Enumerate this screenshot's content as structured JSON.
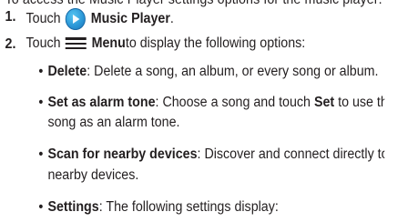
{
  "cut_top_line": "To access the Music Player settings options for the music player:",
  "steps": [
    {
      "num": "1.",
      "prefix": "Touch",
      "icon": "music-player-icon",
      "label": "Music Player",
      "suffix": "."
    },
    {
      "num": "2.",
      "prefix": "Touch",
      "icon": "menu-icon",
      "label": "Menu",
      "suffix": " to display the following options:"
    }
  ],
  "options": [
    {
      "term": "Delete",
      "desc": ": Delete a song, an album, or every song or album."
    },
    {
      "term": "Set as alarm tone",
      "desc": ": Choose a song and touch ",
      "inline_bold": "Set",
      "desc_end": " to use the",
      "continuation": "song as an alarm tone."
    },
    {
      "term": "Scan for nearby devices",
      "desc": ": Discover and connect directly to",
      "continuation": "nearby devices."
    },
    {
      "term": "Settings",
      "desc": ": The following settings display:"
    }
  ],
  "bullet_char": "•",
  "colors": {
    "text": "#231f20",
    "icon_blue": "#2a96d6"
  }
}
